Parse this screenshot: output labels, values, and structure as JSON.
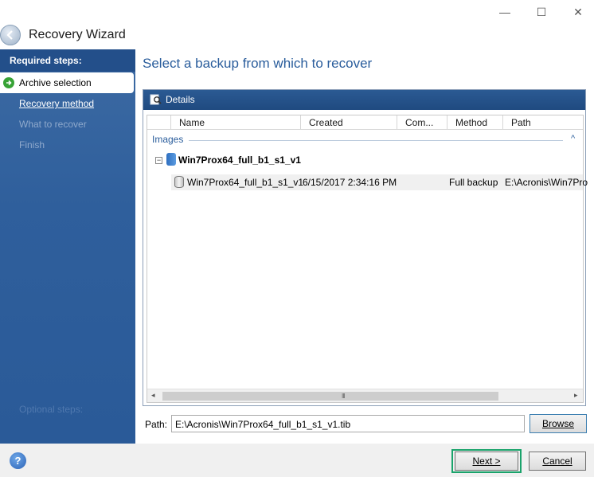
{
  "window": {
    "title": "Recovery Wizard",
    "minimize": "—",
    "maximize": "☐",
    "close": "✕"
  },
  "sidebar": {
    "header": "Required steps:",
    "items": [
      {
        "label": "Archive selection",
        "state": "active"
      },
      {
        "label": "Recovery method",
        "state": "link"
      },
      {
        "label": "What to recover",
        "state": "disabled"
      },
      {
        "label": "Finish",
        "state": "disabled"
      }
    ],
    "optional_header": "Optional steps:"
  },
  "main": {
    "heading": "Select a backup from which to recover",
    "panel_title": "Details",
    "columns": [
      "Name",
      "Created",
      "Com...",
      "Method",
      "Path"
    ],
    "group_label": "Images",
    "group_caret": "^",
    "tree_toggle": "−",
    "node_name": "Win7Prox64_full_b1_s1_v1",
    "rows": [
      {
        "name": "Win7Prox64_full_b1_s1_v1",
        "created": "6/15/2017 2:34:16 PM",
        "comment": "",
        "method": "Full backup",
        "path": "E:\\Acronis\\Win7Pro"
      }
    ],
    "scroll_left": "◂",
    "scroll_right": "▸",
    "scroll_grip": "III"
  },
  "path": {
    "label": "Path:",
    "value": "E:\\Acronis\\Win7Prox64_full_b1_s1_v1.tib",
    "browse_label": "Browse"
  },
  "footer": {
    "help": "?",
    "next_label": "Next >",
    "cancel_label": "Cancel"
  },
  "colors": {
    "sidebar": "#2f5f9c",
    "heading": "#2a5d9c",
    "next_highlight": "#1aa36b",
    "active_arrow": "#37a336"
  }
}
